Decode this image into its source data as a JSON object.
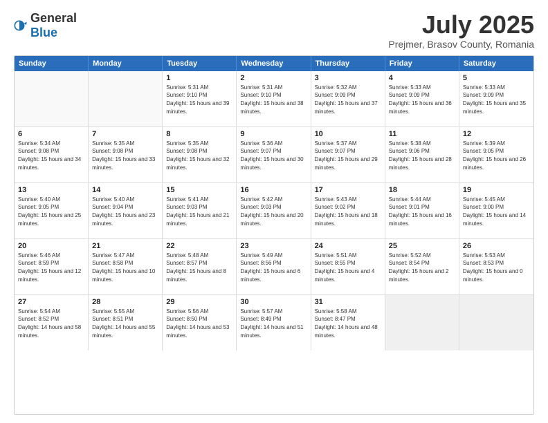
{
  "header": {
    "logo_general": "General",
    "logo_blue": "Blue",
    "title": "July 2025",
    "location": "Prejmer, Brasov County, Romania"
  },
  "calendar": {
    "days_of_week": [
      "Sunday",
      "Monday",
      "Tuesday",
      "Wednesday",
      "Thursday",
      "Friday",
      "Saturday"
    ],
    "weeks": [
      [
        {
          "day": "",
          "empty": true
        },
        {
          "day": "",
          "empty": true
        },
        {
          "day": "1",
          "sunrise": "5:31 AM",
          "sunset": "9:10 PM",
          "daylight": "15 hours and 39 minutes."
        },
        {
          "day": "2",
          "sunrise": "5:31 AM",
          "sunset": "9:10 PM",
          "daylight": "15 hours and 38 minutes."
        },
        {
          "day": "3",
          "sunrise": "5:32 AM",
          "sunset": "9:09 PM",
          "daylight": "15 hours and 37 minutes."
        },
        {
          "day": "4",
          "sunrise": "5:33 AM",
          "sunset": "9:09 PM",
          "daylight": "15 hours and 36 minutes."
        },
        {
          "day": "5",
          "sunrise": "5:33 AM",
          "sunset": "9:09 PM",
          "daylight": "15 hours and 35 minutes."
        }
      ],
      [
        {
          "day": "6",
          "sunrise": "5:34 AM",
          "sunset": "9:08 PM",
          "daylight": "15 hours and 34 minutes."
        },
        {
          "day": "7",
          "sunrise": "5:35 AM",
          "sunset": "9:08 PM",
          "daylight": "15 hours and 33 minutes."
        },
        {
          "day": "8",
          "sunrise": "5:35 AM",
          "sunset": "9:08 PM",
          "daylight": "15 hours and 32 minutes."
        },
        {
          "day": "9",
          "sunrise": "5:36 AM",
          "sunset": "9:07 PM",
          "daylight": "15 hours and 30 minutes."
        },
        {
          "day": "10",
          "sunrise": "5:37 AM",
          "sunset": "9:07 PM",
          "daylight": "15 hours and 29 minutes."
        },
        {
          "day": "11",
          "sunrise": "5:38 AM",
          "sunset": "9:06 PM",
          "daylight": "15 hours and 28 minutes."
        },
        {
          "day": "12",
          "sunrise": "5:39 AM",
          "sunset": "9:05 PM",
          "daylight": "15 hours and 26 minutes."
        }
      ],
      [
        {
          "day": "13",
          "sunrise": "5:40 AM",
          "sunset": "9:05 PM",
          "daylight": "15 hours and 25 minutes."
        },
        {
          "day": "14",
          "sunrise": "5:40 AM",
          "sunset": "9:04 PM",
          "daylight": "15 hours and 23 minutes."
        },
        {
          "day": "15",
          "sunrise": "5:41 AM",
          "sunset": "9:03 PM",
          "daylight": "15 hours and 21 minutes."
        },
        {
          "day": "16",
          "sunrise": "5:42 AM",
          "sunset": "9:03 PM",
          "daylight": "15 hours and 20 minutes."
        },
        {
          "day": "17",
          "sunrise": "5:43 AM",
          "sunset": "9:02 PM",
          "daylight": "15 hours and 18 minutes."
        },
        {
          "day": "18",
          "sunrise": "5:44 AM",
          "sunset": "9:01 PM",
          "daylight": "15 hours and 16 minutes."
        },
        {
          "day": "19",
          "sunrise": "5:45 AM",
          "sunset": "9:00 PM",
          "daylight": "15 hours and 14 minutes."
        }
      ],
      [
        {
          "day": "20",
          "sunrise": "5:46 AM",
          "sunset": "8:59 PM",
          "daylight": "15 hours and 12 minutes."
        },
        {
          "day": "21",
          "sunrise": "5:47 AM",
          "sunset": "8:58 PM",
          "daylight": "15 hours and 10 minutes."
        },
        {
          "day": "22",
          "sunrise": "5:48 AM",
          "sunset": "8:57 PM",
          "daylight": "15 hours and 8 minutes."
        },
        {
          "day": "23",
          "sunrise": "5:49 AM",
          "sunset": "8:56 PM",
          "daylight": "15 hours and 6 minutes."
        },
        {
          "day": "24",
          "sunrise": "5:51 AM",
          "sunset": "8:55 PM",
          "daylight": "15 hours and 4 minutes."
        },
        {
          "day": "25",
          "sunrise": "5:52 AM",
          "sunset": "8:54 PM",
          "daylight": "15 hours and 2 minutes."
        },
        {
          "day": "26",
          "sunrise": "5:53 AM",
          "sunset": "8:53 PM",
          "daylight": "15 hours and 0 minutes."
        }
      ],
      [
        {
          "day": "27",
          "sunrise": "5:54 AM",
          "sunset": "8:52 PM",
          "daylight": "14 hours and 58 minutes."
        },
        {
          "day": "28",
          "sunrise": "5:55 AM",
          "sunset": "8:51 PM",
          "daylight": "14 hours and 55 minutes."
        },
        {
          "day": "29",
          "sunrise": "5:56 AM",
          "sunset": "8:50 PM",
          "daylight": "14 hours and 53 minutes."
        },
        {
          "day": "30",
          "sunrise": "5:57 AM",
          "sunset": "8:49 PM",
          "daylight": "14 hours and 51 minutes."
        },
        {
          "day": "31",
          "sunrise": "5:58 AM",
          "sunset": "8:47 PM",
          "daylight": "14 hours and 48 minutes."
        },
        {
          "day": "",
          "empty": true
        },
        {
          "day": "",
          "empty": true
        }
      ]
    ]
  }
}
